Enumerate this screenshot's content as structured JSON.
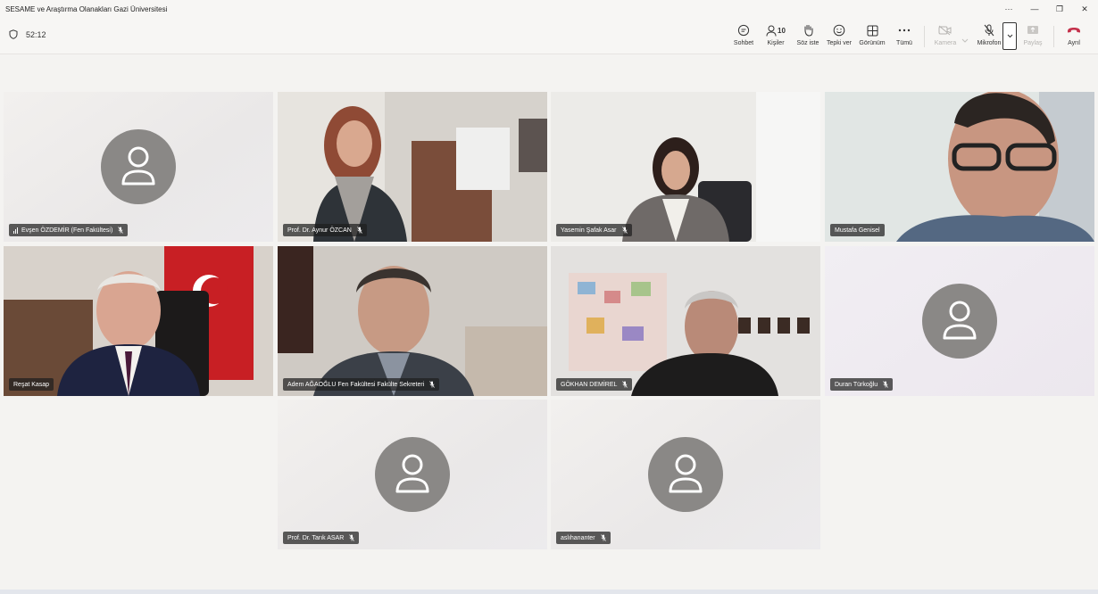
{
  "window": {
    "title": "SESAME ve Araştırma Olanakları Gazi Üniversitesi",
    "more": "···",
    "minimize": "—",
    "restore": "❐",
    "close": "✕"
  },
  "toolbar": {
    "timer": "52:12",
    "chat": "Sohbet",
    "people_label": "Kişiler",
    "people_count": "10",
    "raise_hand": "Söz iste",
    "react": "Tepki ver",
    "view": "Görünüm",
    "more": "Tümü",
    "camera": "Kamera",
    "mic": "Mikrofon",
    "share": "Paylaş",
    "leave": "Ayrıl"
  },
  "colors": {
    "accent": "#5b5fc7",
    "leave": "#c4314b"
  },
  "participants": [
    {
      "name": "Evşen ÖZDEMİR (Fen Fakültesi)",
      "video": false
    },
    {
      "name": "Prof. Dr. Aynur ÖZCAN",
      "video": true
    },
    {
      "name": "Yasemin Şafak Asar",
      "video": true
    },
    {
      "name": "Mustafa Genisel",
      "video": true,
      "active_speaker": true
    },
    {
      "name": "Reşat Kasap",
      "video": true
    },
    {
      "name": "Adem AĞAOĞLU Fen Fakültesi Fakülte Sekreteri",
      "video": true
    },
    {
      "name": "GÖKHAN DEMİREL",
      "video": true
    },
    {
      "name": "Duran Türkoğlu",
      "video": false
    },
    {
      "name": "Prof. Dr. Tarık ASAR",
      "video": false
    },
    {
      "name": "aslıhananter",
      "video": false
    }
  ]
}
